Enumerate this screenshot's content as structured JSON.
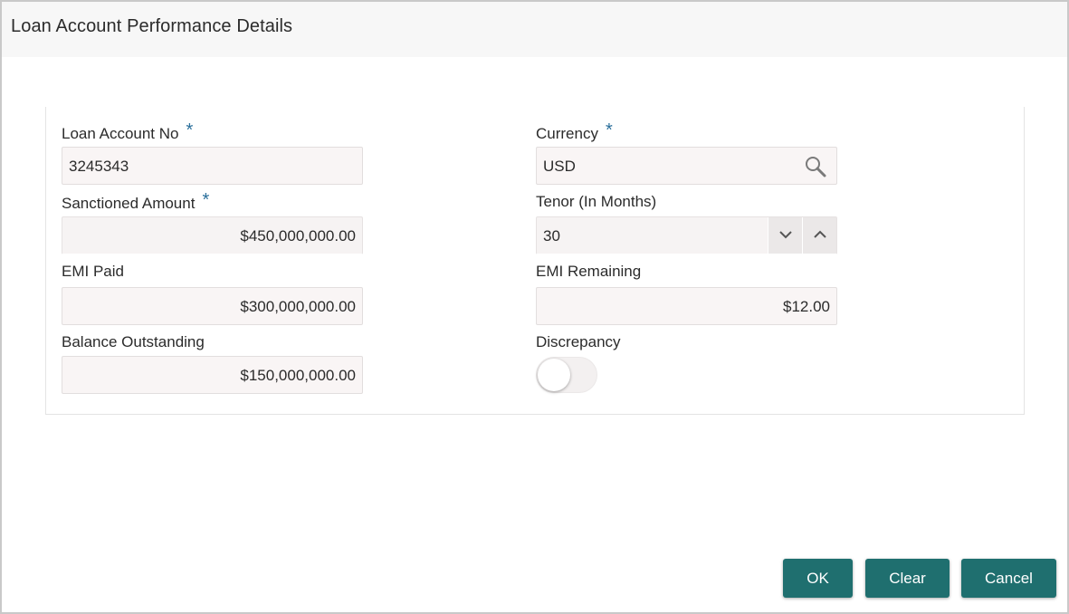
{
  "dialog": {
    "title": "Loan Account Performance Details"
  },
  "form": {
    "loan_account_no": {
      "label": "Loan Account No",
      "required": "*",
      "value": "3245343"
    },
    "currency": {
      "label": "Currency",
      "required": "*",
      "value": "USD"
    },
    "sanctioned_amount": {
      "label": "Sanctioned Amount",
      "required": "*",
      "value": "$450,000,000.00"
    },
    "tenor": {
      "label": "Tenor (In Months)",
      "value": "30"
    },
    "emi_paid": {
      "label": "EMI Paid",
      "value": "$300,000,000.00"
    },
    "emi_remaining": {
      "label": "EMI Remaining",
      "value": "$12.00"
    },
    "balance_outstanding": {
      "label": "Balance Outstanding",
      "value": "$150,000,000.00"
    },
    "discrepancy": {
      "label": "Discrepancy",
      "checked": false
    }
  },
  "actions": {
    "ok_label": "OK",
    "clear_label": "Clear",
    "cancel_label": "Cancel"
  },
  "colors": {
    "accent": "#1f6f6f",
    "required_marker": "#2a6f9b"
  },
  "icons": {
    "currency_lookup": "search-icon",
    "tenor_decrement": "chevron-down-icon",
    "tenor_increment": "chevron-up-icon"
  }
}
